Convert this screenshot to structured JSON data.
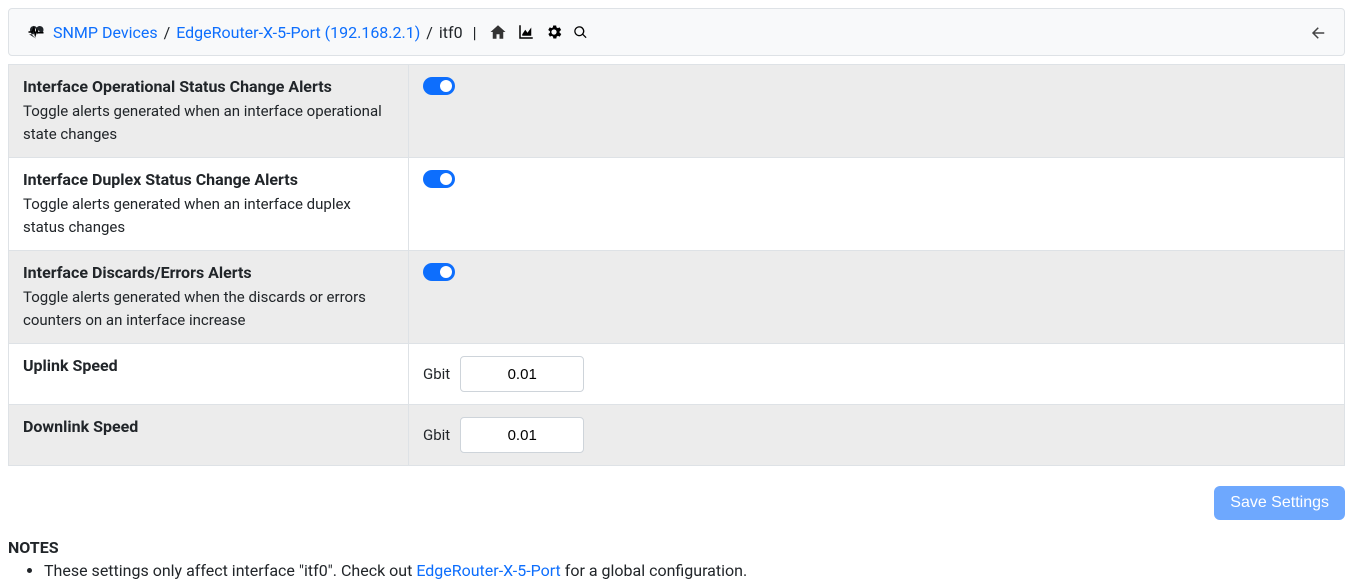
{
  "breadcrumb": {
    "root": "SNMP Devices",
    "device": "EdgeRouter-X-5-Port (192.168.2.1)",
    "current": "itf0",
    "sep": "/",
    "divider": "|"
  },
  "settings": [
    {
      "title": "Interface Operational Status Change Alerts",
      "desc": "Toggle alerts generated when an interface operational state changes",
      "type": "toggle",
      "value": true
    },
    {
      "title": "Interface Duplex Status Change Alerts",
      "desc": "Toggle alerts generated when an interface duplex status changes",
      "type": "toggle",
      "value": true
    },
    {
      "title": "Interface Discards/Errors Alerts",
      "desc": "Toggle alerts generated when the discards or errors counters on an interface increase",
      "type": "toggle",
      "value": true
    },
    {
      "title": "Uplink Speed",
      "desc": "",
      "type": "unit-number",
      "unit": "Gbit",
      "value": "0.01"
    },
    {
      "title": "Downlink Speed",
      "desc": "",
      "type": "unit-number",
      "unit": "Gbit",
      "value": "0.01"
    }
  ],
  "buttons": {
    "save": "Save Settings"
  },
  "notes": {
    "title": "NOTES",
    "prefix": "These settings only affect interface \"itf0\". Check out ",
    "link": "EdgeRouter-X-5-Port",
    "suffix": " for a global configuration."
  }
}
